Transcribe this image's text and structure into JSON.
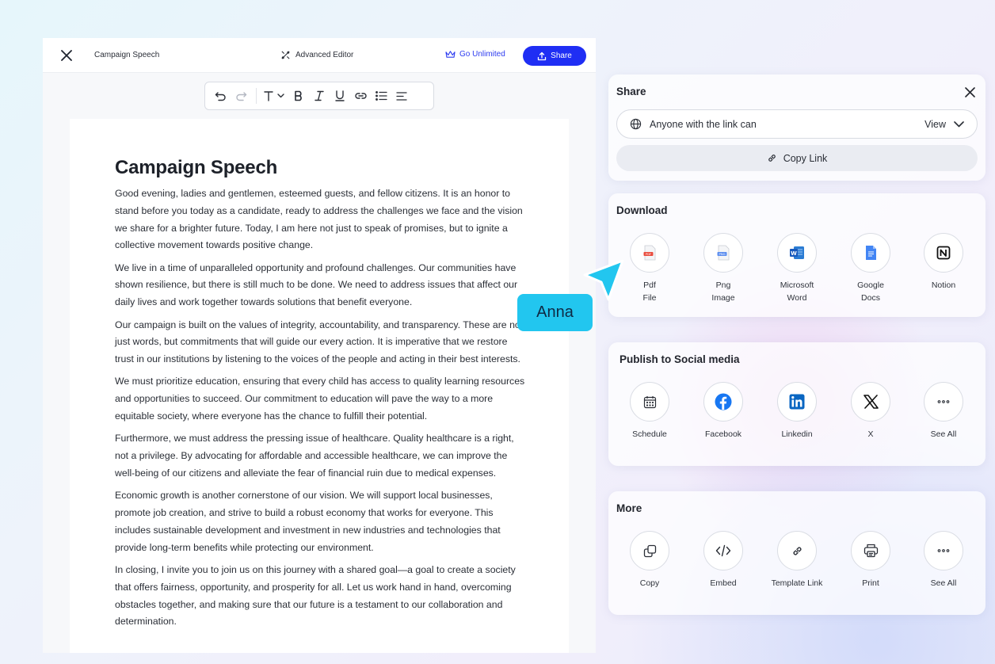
{
  "editor": {
    "doc_title": "Campaign Speech",
    "advanced_editor_label": "Advanced Editor",
    "go_unlimited_label": "Go Unlimited",
    "share_label": "Share",
    "accent_color": "#1f2ef4"
  },
  "document": {
    "heading": "Campaign Speech",
    "paragraphs": [
      "Good evening, ladies and gentlemen, esteemed guests, and fellow citizens. It is an honor to stand before you today as a candidate, ready to address the challenges we face and the vision we share for a brighter future. Today, I am here not just to speak of promises, but to ignite a collective movement towards positive change.",
      "We live in a time of unparalleled opportunity and profound challenges. Our communities have shown resilience, but there is still much to be done. We need to address issues that affect our daily lives and work together towards solutions that benefit everyone.",
      "Our campaign is built on the values of integrity, accountability, and transparency. These are not just words, but commitments that will guide our every action. It is imperative that we restore trust in our institutions by listening to the voices of the people and acting in their best interests.",
      "We must prioritize education, ensuring that every child has access to quality learning resources and opportunities to succeed. Our commitment to education will pave the way to a more equitable society, where everyone has the chance to fulfill their potential.",
      "Furthermore, we must address the pressing issue of healthcare. Quality healthcare is a right, not a privilege. By advocating for affordable and accessible healthcare, we can improve the well-being of our citizens and alleviate the fear of financial ruin due to medical expenses.",
      "Economic growth is another cornerstone of our vision. We will support local businesses, promote job creation, and strive to build a robust economy that works for everyone. This includes sustainable development and investment in new industries and technologies that provide long-term benefits while protecting our environment.",
      "In closing, I invite you to join us on this journey with a shared goal—a goal to create a society that offers fairness, opportunity, and prosperity for all. Let us work hand in hand, overcoming obstacles together, and making sure that our future is a testament to our collaboration and determination."
    ]
  },
  "collaborator": {
    "name": "Anna",
    "color": "#22c6ef"
  },
  "share_panel": {
    "title": "Share",
    "access_text": "Anyone with the link can",
    "access_level": "View",
    "copy_link_label": "Copy Link"
  },
  "download_panel": {
    "title": "Download",
    "items": [
      {
        "label": "Pdf\nFile",
        "icon": "pdf-file-icon"
      },
      {
        "label": "Png\nImage",
        "icon": "png-image-icon"
      },
      {
        "label": "Microsoft\nWord",
        "icon": "word-icon"
      },
      {
        "label": "Google\nDocs",
        "icon": "google-docs-icon"
      },
      {
        "label": "Notion",
        "icon": "notion-icon"
      }
    ]
  },
  "social_panel": {
    "title": "Publish to Social media",
    "items": [
      {
        "label": "Schedule",
        "icon": "calendar-icon"
      },
      {
        "label": "Facebook",
        "icon": "facebook-icon"
      },
      {
        "label": "Linkedin",
        "icon": "linkedin-icon"
      },
      {
        "label": "X",
        "icon": "x-icon"
      },
      {
        "label": "See All",
        "icon": "more-icon"
      }
    ]
  },
  "more_panel": {
    "title": "More",
    "items": [
      {
        "label": "Copy",
        "icon": "copy-icon"
      },
      {
        "label": "Embed",
        "icon": "code-icon"
      },
      {
        "label": "Template Link",
        "icon": "link-icon"
      },
      {
        "label": "Print",
        "icon": "printer-icon"
      },
      {
        "label": "See All",
        "icon": "more-icon"
      }
    ]
  }
}
